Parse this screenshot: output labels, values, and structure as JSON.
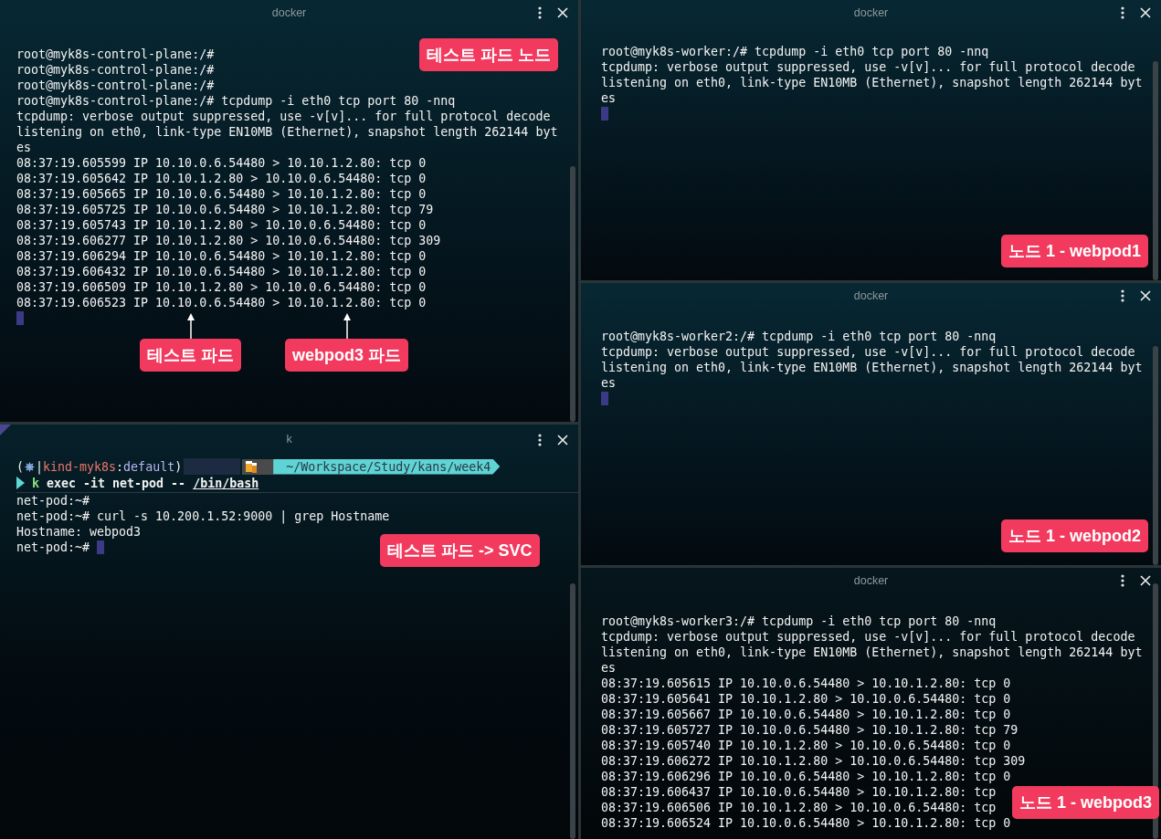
{
  "left_panes": [
    {
      "title": "docker",
      "kind": "tcpdump",
      "active": false,
      "cursor": true,
      "lines": [
        "root@myk8s-control-plane:/#",
        "root@myk8s-control-plane:/#",
        "root@myk8s-control-plane:/#",
        "root@myk8s-control-plane:/# tcpdump -i eth0 tcp port 80 -nnq",
        "tcpdump: verbose output suppressed, use -v[v]... for full protocol decode",
        "listening on eth0, link-type EN10MB (Ethernet), snapshot length 262144 byt",
        "es",
        "08:37:19.605599 IP 10.10.0.6.54480 > 10.10.1.2.80: tcp 0",
        "08:37:19.605642 IP 10.10.1.2.80 > 10.10.0.6.54480: tcp 0",
        "08:37:19.605665 IP 10.10.0.6.54480 > 10.10.1.2.80: tcp 0",
        "08:37:19.605725 IP 10.10.0.6.54480 > 10.10.1.2.80: tcp 79",
        "08:37:19.605743 IP 10.10.1.2.80 > 10.10.0.6.54480: tcp 0",
        "08:37:19.606277 IP 10.10.1.2.80 > 10.10.0.6.54480: tcp 309",
        "08:37:19.606294 IP 10.10.0.6.54480 > 10.10.1.2.80: tcp 0",
        "08:37:19.606432 IP 10.10.0.6.54480 > 10.10.1.2.80: tcp 0",
        "08:37:19.606509 IP 10.10.1.2.80 > 10.10.0.6.54480: tcp 0",
        "08:37:19.606523 IP 10.10.0.6.54480 > 10.10.1.2.80: tcp 0"
      ],
      "callouts": [
        {
          "text": "테스트 파드 노드",
          "arrow": false
        },
        {
          "text": "테스트 파드",
          "arrow": true
        },
        {
          "text": "webpod3 파드",
          "arrow": true
        }
      ]
    },
    {
      "title": "k",
      "kind": "shell",
      "active": true,
      "cursor": true,
      "prompt": {
        "open": "(",
        "separator": "|",
        "cluster": "kind-myk8s",
        "colon": ":",
        "namespace": "default",
        "close": ")",
        "path": "~/Workspace/Study/kans/week4"
      },
      "command": {
        "alias": "k",
        "args": "exec -it net-pod --",
        "target": "/bin/bash"
      },
      "lines": [
        "net-pod:~#",
        "net-pod:~# curl -s 10.200.1.52:9000 | grep Hostname",
        "Hostname: webpod3",
        "net-pod:~# "
      ],
      "callouts": [
        {
          "text": "테스트 파드 -> SVC",
          "arrow": false
        }
      ]
    }
  ],
  "right_panes": [
    {
      "title": "docker",
      "kind": "tcpdump",
      "active": false,
      "cursor": true,
      "lines": [
        "root@myk8s-worker:/# tcpdump -i eth0 tcp port 80 -nnq",
        "tcpdump: verbose output suppressed, use -v[v]... for full protocol decode",
        "listening on eth0, link-type EN10MB (Ethernet), snapshot length 262144 byt",
        "es"
      ],
      "callouts": [
        {
          "text": "노드 1 - webpod1",
          "arrow": false
        }
      ]
    },
    {
      "title": "docker",
      "kind": "tcpdump",
      "active": false,
      "cursor": true,
      "lines": [
        "root@myk8s-worker2:/# tcpdump -i eth0 tcp port 80 -nnq",
        "tcpdump: verbose output suppressed, use -v[v]... for full protocol decode",
        "listening on eth0, link-type EN10MB (Ethernet), snapshot length 262144 byt",
        "es"
      ],
      "callouts": [
        {
          "text": "노드 1 - webpod2",
          "arrow": false
        }
      ]
    },
    {
      "title": "docker",
      "active": false,
      "lines": [
        "root@myk8s-worker3:/# tcpdump -i eth0 tcp port 80 -nnq",
        "tcpdump: verbose output suppressed, use -v[v]... for full protocol decode",
        "listening on eth0, link-type EN10MB (Ethernet), snapshot length 262144 byt",
        "es",
        "08:37:19.605615 IP 10.10.0.6.54480 > 10.10.1.2.80: tcp 0",
        "08:37:19.605641 IP 10.10.1.2.80 > 10.10.0.6.54480: tcp 0",
        "08:37:19.605667 IP 10.10.0.6.54480 > 10.10.1.2.80: tcp 0",
        "08:37:19.605727 IP 10.10.0.6.54480 > 10.10.1.2.80: tcp 79",
        "08:37:19.605740 IP 10.10.1.2.80 > 10.10.0.6.54480: tcp 0",
        "08:37:19.606272 IP 10.10.1.2.80 > 10.10.0.6.54480: tcp 309",
        "08:37:19.606296 IP 10.10.0.6.54480 > 10.10.1.2.80: tcp 0",
        "08:37:19.606437 IP 10.10.0.6.54480 > 10.10.1.2.80: tcp",
        "08:37:19.606506 IP 10.10.1.2.80 > 10.10.0.6.54480: tcp",
        "08:37:19.606524 IP 10.10.0.6.54480 > 10.10.1.2.80: tcp 0"
      ],
      "callouts": [
        {
          "text": "노드 1 - webpod3",
          "arrow": false
        }
      ]
    }
  ]
}
